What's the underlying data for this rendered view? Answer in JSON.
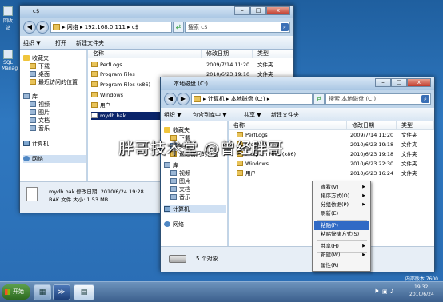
{
  "desktop": {
    "icons": [
      {
        "label": "回收站"
      },
      {
        "label": "SQL Manag"
      }
    ]
  },
  "window1": {
    "title": "c$",
    "address": "▸ 网络 ▸ 192.168.0.111 ▸ c$",
    "search_placeholder": "搜索 c$",
    "toolbar": {
      "organize": "组织 ▼",
      "open": "打开",
      "new_folder": "新建文件夹"
    },
    "nav": [
      "收藏夹",
      "下载",
      "桌面",
      "最近访问的位置",
      "库",
      "视频",
      "图片",
      "文档",
      "音乐",
      "计算机",
      "网络"
    ],
    "columns": [
      "名称",
      "修改日期",
      "类型"
    ],
    "rows": [
      {
        "name": "PerfLogs",
        "date": "2009/7/14 11:20",
        "type": "文件夹"
      },
      {
        "name": "Program Files",
        "date": "2010/6/23 19:10",
        "type": "文件夹"
      },
      {
        "name": "Program Files (x86)",
        "date": "",
        "type": ""
      },
      {
        "name": "Windows",
        "date": "",
        "type": ""
      },
      {
        "name": "用户",
        "date": "",
        "type": ""
      },
      {
        "name": "mydb.bak",
        "date": "",
        "type": ""
      }
    ],
    "details": {
      "line1": "mydb.bak 修改日期: 2010/6/24 19:28",
      "line2": "BAK 文件    大小: 1.53 MB"
    }
  },
  "window2": {
    "title": "本地磁盘 (C:)",
    "address": "▸ 计算机 ▸ 本地磁盘 (C:) ▸",
    "search_placeholder": "搜索 本地磁盘 (C:)",
    "toolbar": {
      "organize": "组织 ▼",
      "include_library": "包含到库中 ▼",
      "share": "共享 ▼",
      "new_folder": "新建文件夹"
    },
    "nav": [
      "收藏夹",
      "下载",
      "桌面",
      "最近访问的位置",
      "库",
      "视频",
      "图片",
      "文档",
      "音乐",
      "计算机",
      "网络"
    ],
    "columns": [
      "名称",
      "修改日期",
      "类型"
    ],
    "rows": [
      {
        "name": "PerfLogs",
        "date": "2009/7/14 11:20",
        "type": "文件夹"
      },
      {
        "name": "Program Files",
        "date": "2010/6/23 19:18",
        "type": "文件夹"
      },
      {
        "name": "Program Files (x86)",
        "date": "2010/6/23 19:18",
        "type": "文件夹"
      },
      {
        "name": "Windows",
        "date": "2010/6/23 22:30",
        "type": "文件夹"
      },
      {
        "name": "用户",
        "date": "2010/6/23 16:24",
        "type": "文件夹"
      }
    ],
    "status": "5 个对象"
  },
  "context_menu": [
    {
      "label": "查看(V)",
      "sub": true
    },
    {
      "label": "排序方式(O)",
      "sub": true
    },
    {
      "label": "分组依据(P)",
      "sub": true
    },
    {
      "label": "刷新(E)",
      "sub": false
    },
    {
      "label": "粘贴(P)",
      "sub": false,
      "highlight": true
    },
    {
      "label": "粘贴快捷方式(S)",
      "sub": false
    },
    {
      "label": "共享(H)",
      "sub": true
    },
    {
      "label": "新建(W)",
      "sub": true
    },
    {
      "label": "属性(R)",
      "sub": false
    }
  ],
  "watermark": "胖哥技术堂 @曾经胖哥",
  "taskbar": {
    "start": "开始"
  },
  "tray": {
    "info": "内部版本 7600",
    "time": "19:32",
    "date": "2010/6/24"
  }
}
